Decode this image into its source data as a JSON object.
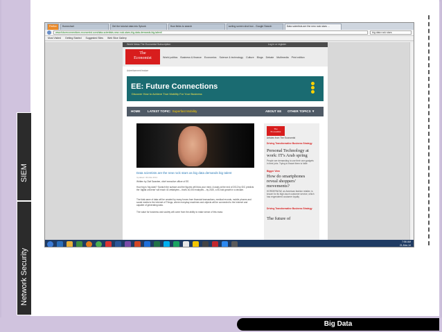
{
  "slide": {
    "side_label_top": "SIEM",
    "side_label_bottom": "Network Security",
    "footer": "Big Data"
  },
  "browser": {
    "tabs": [
      {
        "label": "Firefox",
        "state": "first"
      },
      {
        "label": "Homechart"
      },
      {
        "label": "Get the tutorial data into Splunk"
      },
      {
        "label": "How fields to search"
      },
      {
        "label": "sorting screen shot box - Google Search"
      },
      {
        "label": "Data scientists are the new rock stars ...",
        "state": "active"
      }
    ],
    "url": "www.futureconnections.economist.com/data-scientists-new-rock-stars-big-data-demands-big-talent/",
    "search_value": "big data rock stars",
    "bookmarks": [
      "Most Visited",
      "Getting Started",
      "Suggested Sites",
      "Web Slice Gallery"
    ]
  },
  "site": {
    "topstrip_left": "World News The Economist   Subscription",
    "topstrip_right": "Log in or register",
    "logo_line1": "The",
    "logo_line2": "Economist",
    "menu": [
      "World politics",
      "Business & finance",
      "Economics",
      "Science & technology",
      "Culture",
      "Blogs",
      "Debate",
      "Multimedia",
      "Print edition"
    ],
    "ad_notice": "Advertisement feature"
  },
  "banner": {
    "title": "EE: Future Connections",
    "subtitle": "Discover How to Achieve True Mobility For Your Business",
    "brand_color": "#1a6b71"
  },
  "topicbar": {
    "home": "HOME",
    "latest": "LATEST TOPIC:",
    "latest_value": "Superfast Mobility",
    "about": "ABOUT EE",
    "other": "OTHER TOPICS ▼"
  },
  "article": {
    "title": "Data scientists are the new rock stars as big data demands big talent",
    "date": "Updated: 06-Mar-2014",
    "p1": "Written by Olaf Swantee, chief executive officer of EE.",
    "p2": "How big is 'big data'? Scratch the surface and the figures will blow your mind. A study at the end of 2012 by IDC predicts the 'digital universe' will reach 40 zettabytes – that's 40,000 exabytes – by 2020, a 50-fold growth in a decade.",
    "p3": "The tidal wave of data will be created by many forces from financial transactions, medical records, mobile phones and social media to the Internet of Things, where everyday machines and objects will be connected to the Internet and capable of generating data.",
    "p4": "The value for business and society will come from the ability to make sense of this mass"
  },
  "sidebar": {
    "logo_line1": "The",
    "logo_line2": "Economist",
    "articles_label": "Articles from The Economist",
    "items": [
      {
        "tag": "Driving Transformative Business Strategy",
        "headline": "Personal Technology at work: IT's Arab spring",
        "blurb": "People are demanding to use their own gadgets in their jobs. Trying to thwart them is futile"
      },
      {
        "tag": "Bigger View",
        "headline": "How do smartphones reveal shoppers' movements?",
        "blurb": "HORDERNOW, an American fashion retailer, is known for its high-touch customer service, which has engendered customer loyalty"
      },
      {
        "tag": "Driving Transformative Business Strategy",
        "headline": "The future of",
        "blurb": ""
      }
    ]
  },
  "taskbar": {
    "time": "7:56 AM",
    "date": "21-Mar-14"
  }
}
